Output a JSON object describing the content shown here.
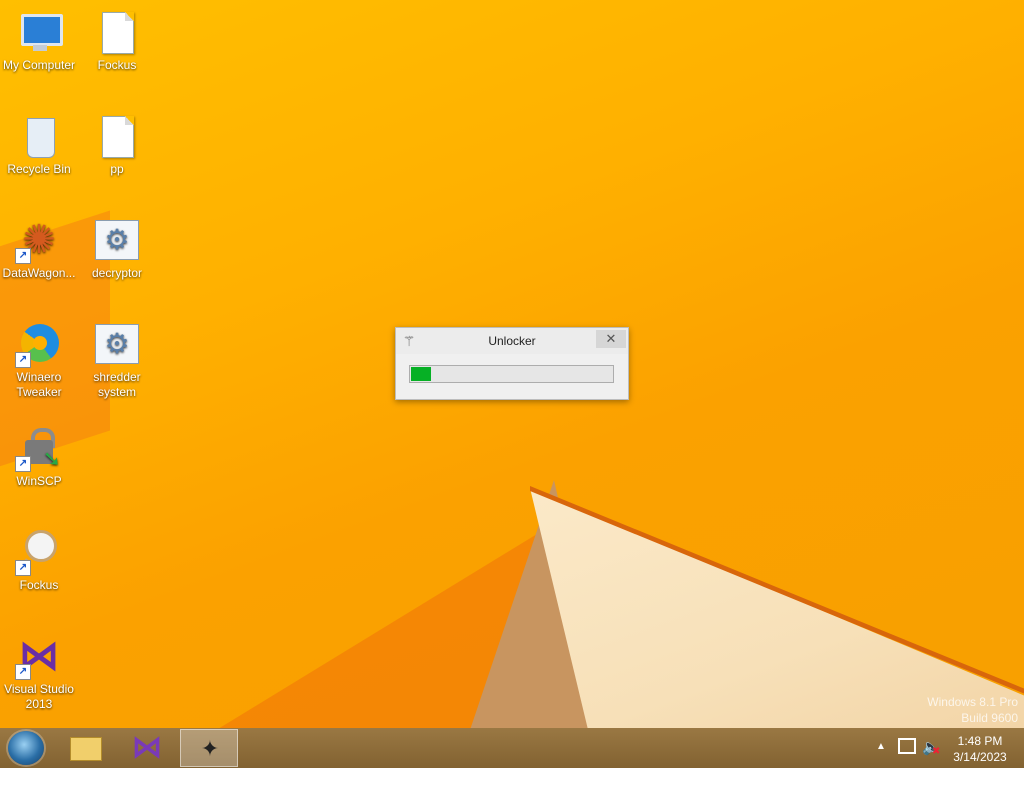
{
  "desktop": {
    "icons": [
      {
        "label": "My Computer",
        "icon": "computer-icon"
      },
      {
        "label": "Fockus",
        "icon": "text-file-icon"
      },
      {
        "label": "Recycle Bin",
        "icon": "recycle-bin-icon"
      },
      {
        "label": "pp",
        "icon": "text-file-icon"
      },
      {
        "label": "DataWagon...",
        "icon": "datawagon-star-icon"
      },
      {
        "label": "decryptor",
        "icon": "gear-config-icon"
      },
      {
        "label": "Winaero Tweaker",
        "icon": "winaero-tweaker-icon"
      },
      {
        "label": "shredder system",
        "icon": "gear-config-icon"
      },
      {
        "label": "WinSCP",
        "icon": "winscp-lock-icon"
      },
      {
        "label": "Fockus",
        "icon": "magnifier-icon"
      },
      {
        "label": "Visual Studio 2013",
        "icon": "visual-studio-icon"
      }
    ],
    "watermark": {
      "line1": "Windows 8.1 Pro",
      "line2": "Build 9600"
    }
  },
  "dialog": {
    "title": "Unlocker",
    "icon": "magic-wand-icon",
    "close_glyph": "✕",
    "progress_fraction": 0.1
  },
  "taskbar": {
    "start_icon": "start-orb-icon",
    "pinned": [
      {
        "name": "file-explorer",
        "icon": "folder-icon",
        "active": false
      },
      {
        "name": "visual-studio",
        "icon": "visual-studio-icon",
        "active": false
      },
      {
        "name": "unlocker",
        "icon": "magic-wand-icon",
        "active": true
      }
    ],
    "tray": {
      "up_arrow_glyph": "▲",
      "network_icon": "network-icon",
      "volume_icon": "speaker-muted-icon",
      "time": "1:48 PM",
      "date": "3/14/2023"
    }
  },
  "colors": {
    "desktop_accent": "#ffb000",
    "progress": "#06b025",
    "taskbar": "#8b6a36"
  }
}
